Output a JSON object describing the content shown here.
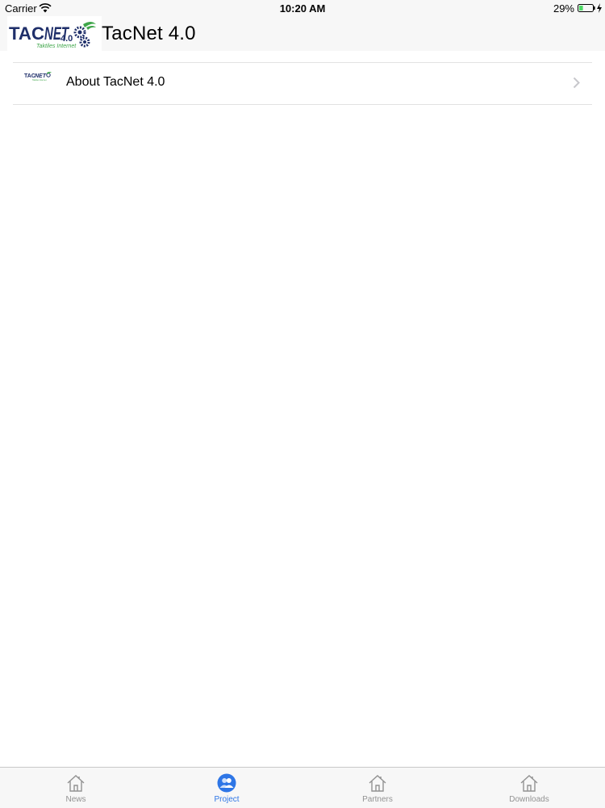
{
  "status_bar": {
    "carrier": "Carrier",
    "time": "10:20 AM",
    "battery_percent": "29%",
    "battery_level": 0.29
  },
  "nav": {
    "title": "TacNet 4.0",
    "logo": {
      "text": "TACNET",
      "version": "4.0",
      "tagline": "Taktiles Internet"
    }
  },
  "table": {
    "rows": [
      {
        "label": "About TacNet 4.0",
        "icon": "tacnet-logo"
      }
    ]
  },
  "tab_bar": {
    "active": "Project",
    "tabs": [
      {
        "label": "News",
        "icon": "home-icon"
      },
      {
        "label": "Project",
        "icon": "people-icon"
      },
      {
        "label": "Partners",
        "icon": "home-icon"
      },
      {
        "label": "Downloads",
        "icon": "home-icon"
      }
    ]
  },
  "colors": {
    "accent": "#2e76e6",
    "logo_navy": "#1f2f6a",
    "logo_green": "#3fa64a",
    "battery_green": "#4cd964"
  }
}
